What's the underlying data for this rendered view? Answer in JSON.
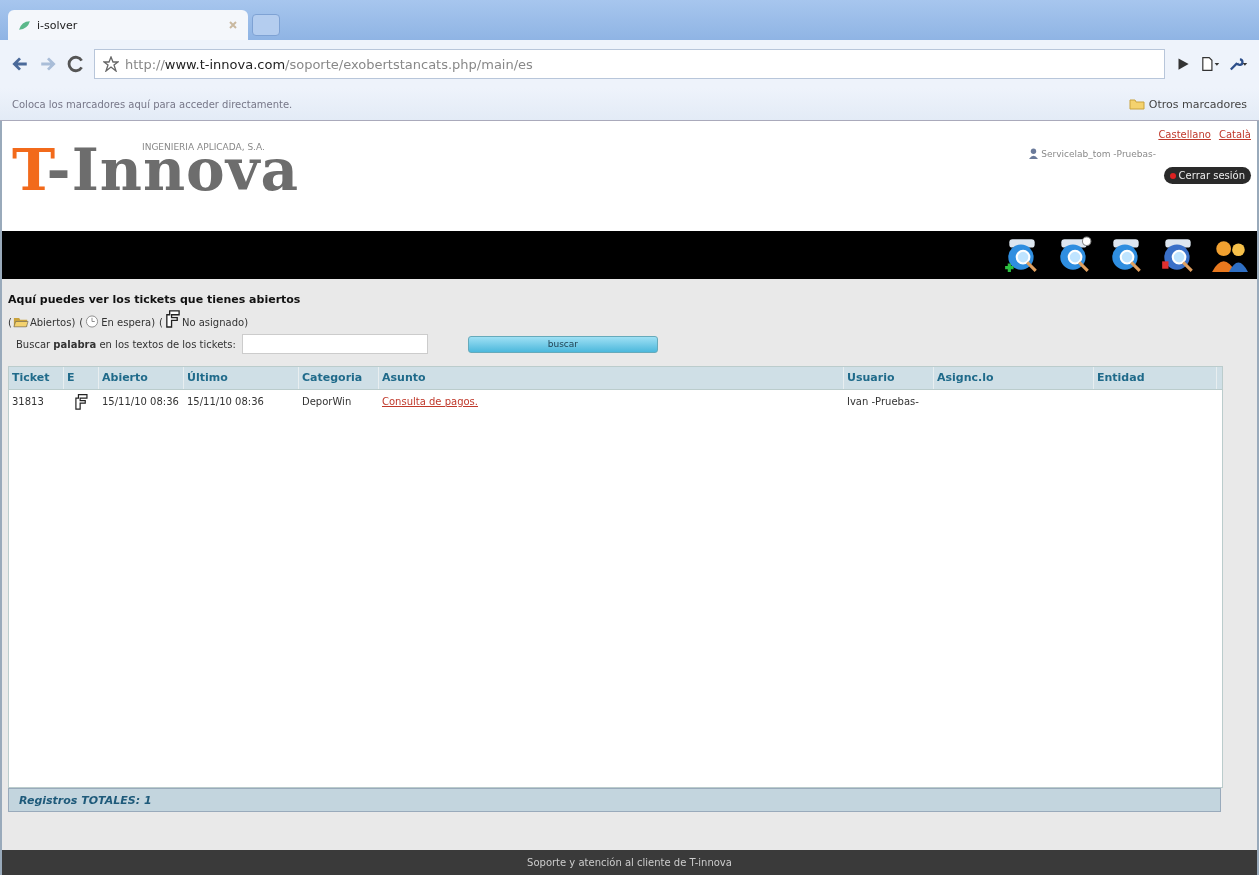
{
  "browser": {
    "tab": {
      "title": "i-solver"
    },
    "url": {
      "prefix": "http://",
      "domain": "www.t-innova.com",
      "path": "/soporte/exobertstancats.php/main/es"
    },
    "bookmarks_hint": "Coloca los marcadores aquí para acceder directamente.",
    "other_bookmarks": "Otros marcadores"
  },
  "header": {
    "logo_t": "T",
    "logo_rest": "-Innova",
    "logo_tagline": "INGENIERIA APLICADA, S.A.",
    "languages": [
      {
        "label": "Castellano"
      },
      {
        "label": "Català"
      }
    ],
    "user": "Servicelab_tom -Pruebas-",
    "logout": "Cerrar sesión"
  },
  "toolbar": {
    "icons": [
      {
        "kind": "new-search"
      },
      {
        "kind": "alert-search"
      },
      {
        "kind": "search"
      },
      {
        "kind": "red-search"
      },
      {
        "kind": "users"
      }
    ]
  },
  "content": {
    "title": "Aquí puedes ver los tickets que tienes abiertos",
    "legend": [
      {
        "kind": "folder",
        "open": "(",
        "label": "Abiertos)"
      },
      {
        "kind": "clock",
        "open": "(",
        "label": "En espera)"
      },
      {
        "kind": "hand",
        "open": "(",
        "label": "No asignado)"
      }
    ],
    "search": {
      "label": "Buscar **palabra** en los textos de los tickets:",
      "button": "buscar"
    },
    "table": {
      "columns": [
        "Ticket",
        "E",
        "Abierto",
        "Último",
        "Categoria",
        "Asunto",
        "Usuario",
        "Asignc.lo",
        "Entidad"
      ],
      "rows": [
        {
          "ticket": "31813",
          "kind": "hand",
          "opened": "15/11/10 08:36",
          "last": "15/11/10 08:36",
          "category": "DeporWin",
          "subject": "Consulta de pagos.",
          "user": "Ivan -Pruebas-"
        }
      ]
    },
    "totals": "Registros TOTALES: 1"
  },
  "footer": "Soporte y atención al cliente de T-innova"
}
